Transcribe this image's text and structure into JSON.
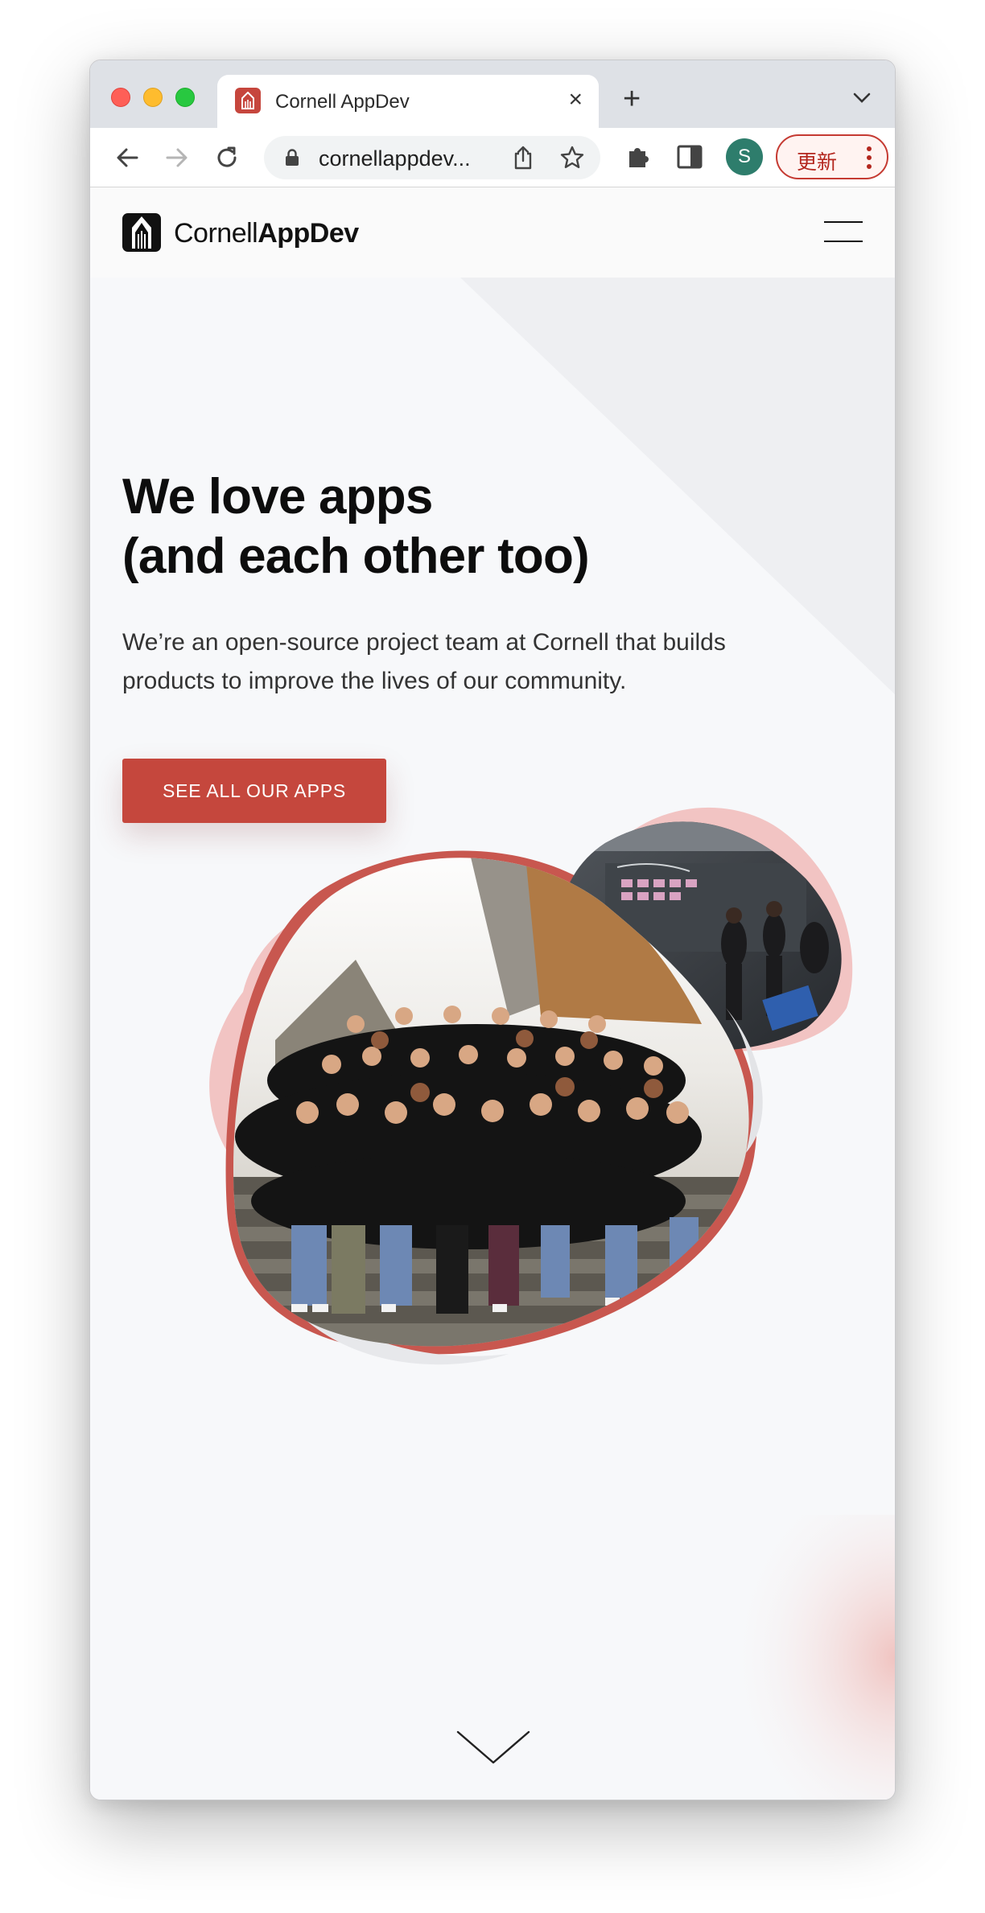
{
  "browser": {
    "tab_title": "Cornell AppDev",
    "url": "cornellappdev...",
    "profile_initial": "S",
    "update_label": "更新"
  },
  "site": {
    "brand_regular": "Cornell",
    "brand_bold": "AppDev",
    "hero_title_line1": "We love apps",
    "hero_title_line2": "(and each other too)",
    "hero_subtitle": "We’re an open-source project team at Cornell that builds products to improve the lives of our community.",
    "cta_label": "SEE ALL OUR APPS"
  },
  "colors": {
    "accent": "#c5473d",
    "blob_pink": "#f2c4c3",
    "blob_red": "#c8574f",
    "page_bg": "#f7f8fa"
  }
}
